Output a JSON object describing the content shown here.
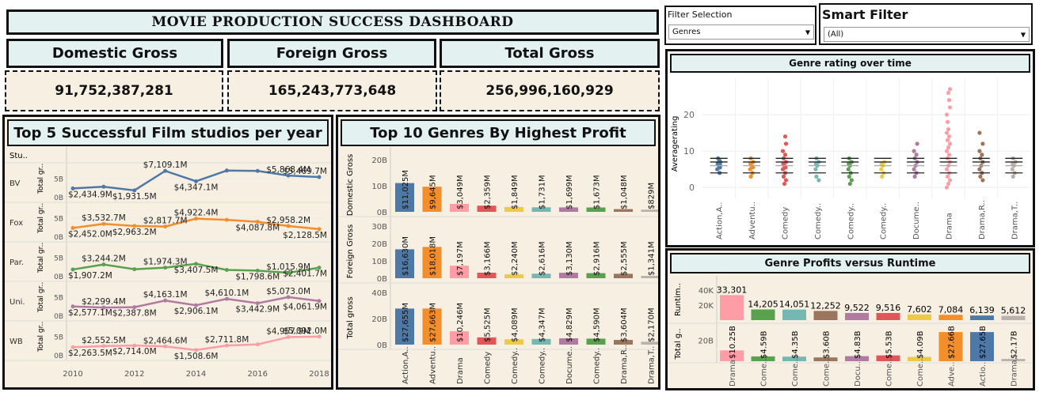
{
  "title": "MOVIE PRODUCTION SUCCESS DASHBOARD",
  "filters": {
    "filter_selection_label": "Filter Selection",
    "filter_selection_value": "Genres",
    "smart_filter_label": "Smart Filter",
    "smart_filter_value": "(All)"
  },
  "kpis": [
    {
      "label": "Domestic Gross",
      "value": "91,752,387,281"
    },
    {
      "label": "Foreign Gross",
      "value": "165,243,773,648"
    },
    {
      "label": "Total Gross",
      "value": "256,996,160,929"
    }
  ],
  "colors": {
    "blue": "#4e79a7",
    "orange": "#f28e2b",
    "pink": "#ff9da7",
    "red": "#e15759",
    "yellow": "#edc948",
    "teal": "#76b7b2",
    "purple": "#b07aa1",
    "green": "#59a14f",
    "brown": "#9c755f",
    "grey": "#bab0ac"
  },
  "chart_data": [
    {
      "type": "line",
      "title": "Top 5 Successful Film studios per year",
      "row_header": "Stu..",
      "ylabel": "Total gr..",
      "x": [
        2010,
        2011,
        2012,
        2013,
        2014,
        2015,
        2016,
        2017,
        2018
      ],
      "xticks": [
        "2010",
        "2012",
        "2014",
        "2016",
        "2018"
      ],
      "yticks": [
        "5B",
        "0B"
      ],
      "series": [
        {
          "name": "BV",
          "color": "#4e79a7",
          "values": [
            2434.9,
            2900,
            1931.5,
            7109.1,
            4347.1,
            7200,
            7100,
            5868.4,
            5469.7
          ],
          "labels": [
            {
              "i": 0,
              "t": "$2,434.9M"
            },
            {
              "i": 2,
              "t": "$1,931.5M"
            },
            {
              "i": 3,
              "t": "$7,109.1M"
            },
            {
              "i": 4,
              "t": "$4,347.1M"
            },
            {
              "i": 7,
              "t": "$5,868.4M"
            },
            {
              "i": 8,
              "t": "$5,469.7M"
            }
          ]
        },
        {
          "name": "Fox",
          "color": "#f28e2b",
          "values": [
            2452.0,
            3532.7,
            2963.2,
            2817.7,
            4922.4,
            4600,
            4087.8,
            2958.2,
            2128.5
          ],
          "labels": [
            {
              "i": 0,
              "t": "$2,452.0M"
            },
            {
              "i": 1,
              "t": "$3,532.7M"
            },
            {
              "i": 2,
              "t": "$2,963.2M"
            },
            {
              "i": 3,
              "t": "$2,817.7M"
            },
            {
              "i": 4,
              "t": "$4,922.4M"
            },
            {
              "i": 6,
              "t": "$4,087.8M"
            },
            {
              "i": 7,
              "t": "$2,958.2M"
            },
            {
              "i": 8,
              "t": "$2,128.5M"
            }
          ]
        },
        {
          "name": "Par.",
          "color": "#59a14f",
          "values": [
            1907.2,
            3244.2,
            1974.3,
            2400,
            3407.5,
            1798.6,
            1600,
            1015.9,
            2401.7
          ],
          "labels": [
            {
              "i": 0,
              "t": "$1,907.2M"
            },
            {
              "i": 1,
              "t": "$3,244.2M"
            },
            {
              "i": 3,
              "t": "$1,974.3M"
            },
            {
              "i": 4,
              "t": "$3,407.5M"
            },
            {
              "i": 6,
              "t": "$1,798.6M"
            },
            {
              "i": 7,
              "t": "$1,015.9M"
            },
            {
              "i": 8,
              "t": "$2,401.7M"
            }
          ]
        },
        {
          "name": "Uni.",
          "color": "#b07aa1",
          "values": [
            2577.1,
            2299.4,
            2387.8,
            4163.1,
            2906.1,
            4610.1,
            3442.9,
            5073.0,
            4061.9
          ],
          "labels": [
            {
              "i": 0,
              "t": "$2,577.1M"
            },
            {
              "i": 1,
              "t": "$2,299.4M"
            },
            {
              "i": 2,
              "t": "$2,387.8M"
            },
            {
              "i": 3,
              "t": "$4,163.1M"
            },
            {
              "i": 4,
              "t": "$2,906.1M"
            },
            {
              "i": 5,
              "t": "$4,610.1M"
            },
            {
              "i": 6,
              "t": "$3,442.9M"
            },
            {
              "i": 7,
              "t": "$5,073.0M"
            },
            {
              "i": 8,
              "t": "$4,061.9M"
            }
          ]
        },
        {
          "name": "WB",
          "color": "#ff9da7",
          "values": [
            2263.5,
            2552.5,
            2714.0,
            2464.6,
            1508.6,
            2711.8,
            3000,
            4957.9,
            5092.0
          ],
          "labels": [
            {
              "i": 0,
              "t": "$2,263.5M"
            },
            {
              "i": 1,
              "t": "$2,552.5M"
            },
            {
              "i": 2,
              "t": "$2,714.0M"
            },
            {
              "i": 3,
              "t": "$2,464.6M"
            },
            {
              "i": 4,
              "t": "$1,508.6M"
            },
            {
              "i": 5,
              "t": "$2,711.8M"
            },
            {
              "i": 7,
              "t": "$4,957.9M"
            },
            {
              "i": 8,
              "t": "$5,092.0M"
            }
          ]
        }
      ]
    },
    {
      "type": "bar",
      "title": "Top 10 Genres By Highest Profit",
      "categories": [
        "Action,A..",
        "Adventu..",
        "Drama",
        "Comedy",
        "Comedy..",
        "Comedy..",
        "Docume..",
        "Comedy..",
        "Drama,R..",
        "Drama,T.."
      ],
      "colors": [
        "#4e79a7",
        "#f28e2b",
        "#ff9da7",
        "#e15759",
        "#edc948",
        "#76b7b2",
        "#b07aa1",
        "#59a14f",
        "#9c755f",
        "#bab0ac"
      ],
      "series": [
        {
          "name": "Domestic Gross",
          "yticks": [
            "20B",
            "10B",
            "0B"
          ],
          "ymax": 20,
          "values": [
            11.025,
            9.645,
            3.049,
            2.359,
            1.849,
            1.731,
            1.699,
            1.673,
            1.048,
            0.829
          ],
          "labels": [
            "$11,025M",
            "$9,645M",
            "$3,049M",
            "$2,359M",
            "$1,849M",
            "$1,731M",
            "$1,699M",
            "$1,673M",
            "$1,048M",
            "$829M"
          ]
        },
        {
          "name": "Foreign Gross",
          "yticks": [
            "30B",
            "20B",
            "10B",
            "0B"
          ],
          "ymax": 30,
          "values": [
            16.63,
            18.018,
            7.197,
            3.166,
            2.24,
            2.616,
            3.13,
            2.916,
            2.555,
            1.341
          ],
          "labels": [
            "$16,630M",
            "$18,018M",
            "$7,197M",
            "$3,166M",
            "$2,240M",
            "$2,616M",
            "$3,130M",
            "$2,916M",
            "$2,555M",
            "$1,341M"
          ]
        },
        {
          "name": "Total gross",
          "yticks": [
            "40B",
            "20B",
            "0B"
          ],
          "ymax": 40,
          "values": [
            27.655,
            27.663,
            10.246,
            5.525,
            4.089,
            4.347,
            4.829,
            4.59,
            3.604,
            2.17
          ],
          "labels": [
            "$27,655M",
            "$27,663M",
            "$10,246M",
            "$5,525M",
            "$4,089M",
            "$4,347M",
            "$4,829M",
            "$4,590M",
            "$3,604M",
            "$2,170M"
          ]
        }
      ]
    },
    {
      "type": "scatter",
      "title": "Genre rating over  time",
      "ylabel": "Averagerating",
      "ylim": [
        -3,
        30
      ],
      "yticks": [
        20,
        10,
        0
      ],
      "categories": [
        "Action,A..",
        "Adventu..",
        "Comedy",
        "Comedy..",
        "Comedy..",
        "Comedy..",
        "Docume..",
        "Drama",
        "Drama,R..",
        "Drama,T.."
      ],
      "colors": [
        "#4e79a7",
        "#f28e2b",
        "#e15759",
        "#76b7b2",
        "#59a14f",
        "#edc948",
        "#b07aa1",
        "#ff9da7",
        "#9c755f",
        "#bab0ac"
      ],
      "points": [
        [
          5,
          6,
          7,
          8,
          6.5,
          5.5,
          4,
          7.5,
          6.2
        ],
        [
          5,
          6,
          7,
          8,
          3,
          4,
          6.5,
          5.5
        ],
        [
          3,
          4,
          5,
          6,
          7,
          8,
          9,
          10,
          12,
          14,
          2,
          1,
          5.5,
          6.5
        ],
        [
          5,
          6,
          7,
          8,
          3,
          2,
          6.5
        ],
        [
          4,
          5,
          6,
          7,
          8,
          2,
          1,
          3,
          6.5
        ],
        [
          5,
          6,
          7,
          3,
          4,
          6.5
        ],
        [
          6,
          7,
          8,
          9,
          10,
          12,
          5,
          4,
          3
        ],
        [
          5,
          6,
          7,
          8,
          10,
          12,
          14,
          16,
          18,
          20,
          22,
          24,
          26,
          27,
          3,
          1,
          0,
          2,
          4,
          9,
          11,
          13,
          15
        ],
        [
          4,
          5,
          6,
          7,
          8,
          10,
          12,
          15,
          2,
          3,
          9
        ],
        [
          5,
          6,
          7,
          8,
          3,
          4,
          6.5
        ]
      ]
    },
    {
      "type": "bar",
      "title": "Genre Profits versus Runtime",
      "categories": [
        "Drama",
        "Come..",
        "Come..",
        "Come..",
        "Docu..",
        "Come..",
        "Come..",
        "Adve..",
        "Actio..",
        "Drama,.."
      ],
      "colors": [
        "#ff9da7",
        "#59a14f",
        "#76b7b2",
        "#9c755f",
        "#b07aa1",
        "#e15759",
        "#edc948",
        "#f28e2b",
        "#4e79a7",
        "#bab0ac"
      ],
      "series": [
        {
          "name": "Runtim..",
          "yticks": [
            "40K",
            "20K"
          ],
          "ymax": 40000,
          "values": [
            33301,
            14205,
            14051,
            12252,
            9522,
            9516,
            7602,
            7084,
            6139,
            5612
          ],
          "labels": [
            "33,301",
            "14,205",
            "14,051",
            "12,252",
            "9,522",
            "9,516",
            "7,602",
            "7,084",
            "6,139",
            "5,612"
          ]
        },
        {
          "name": "Total g..",
          "yticks": [
            "20B"
          ],
          "ymax": 30,
          "values": [
            10.25,
            4.59,
            4.35,
            3.6,
            4.83,
            5.53,
            4.09,
            27.66,
            27.65,
            2.17
          ],
          "labels": [
            "$10.25B",
            "$4.59B",
            "$4.35B",
            "$3.60B",
            "$4.83B",
            "$5.53B",
            "$4.09B",
            "$27.66B",
            "$27.65B",
            "$2.17B"
          ]
        }
      ]
    }
  ]
}
